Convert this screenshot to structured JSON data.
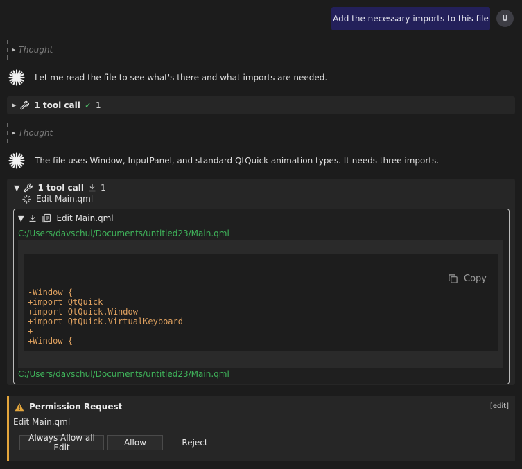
{
  "user": {
    "message": "Add the necessary imports to this file",
    "avatar_letter": "U"
  },
  "conversation": {
    "thought_label": "Thought",
    "assistant_message_1": "Let me read the file to see what's there and what imports are needed.",
    "tool_call_1": {
      "label": "1 tool call",
      "count": "1"
    },
    "assistant_message_2": "The file uses Window, InputPanel, and standard QtQuick animation types. It needs three imports.",
    "tool_call_2": {
      "label": "1 tool call",
      "count": "1",
      "sub_label": "Edit Main.qml",
      "edit": {
        "title": "Edit Main.qml",
        "path": "C:/Users/davschul/Documents/untitled23/Main.qml",
        "copy_label": "Copy",
        "code_lines": [
          "-Window {",
          "+import QtQuick",
          "+import QtQuick.Window",
          "+import QtQuick.VirtualKeyboard",
          "+",
          "+Window {"
        ]
      }
    }
  },
  "permission": {
    "title": "Permission Request",
    "tag": "[edit]",
    "description": "Edit Main.qml",
    "buttons": {
      "always_allow": "Always Allow all Edit",
      "allow": "Allow",
      "reject": "Reject"
    }
  },
  "colors": {
    "accent_green": "#3fb35a",
    "warning_orange": "#e3a63c",
    "user_bubble": "#23205a",
    "code_text": "#e0a260"
  }
}
